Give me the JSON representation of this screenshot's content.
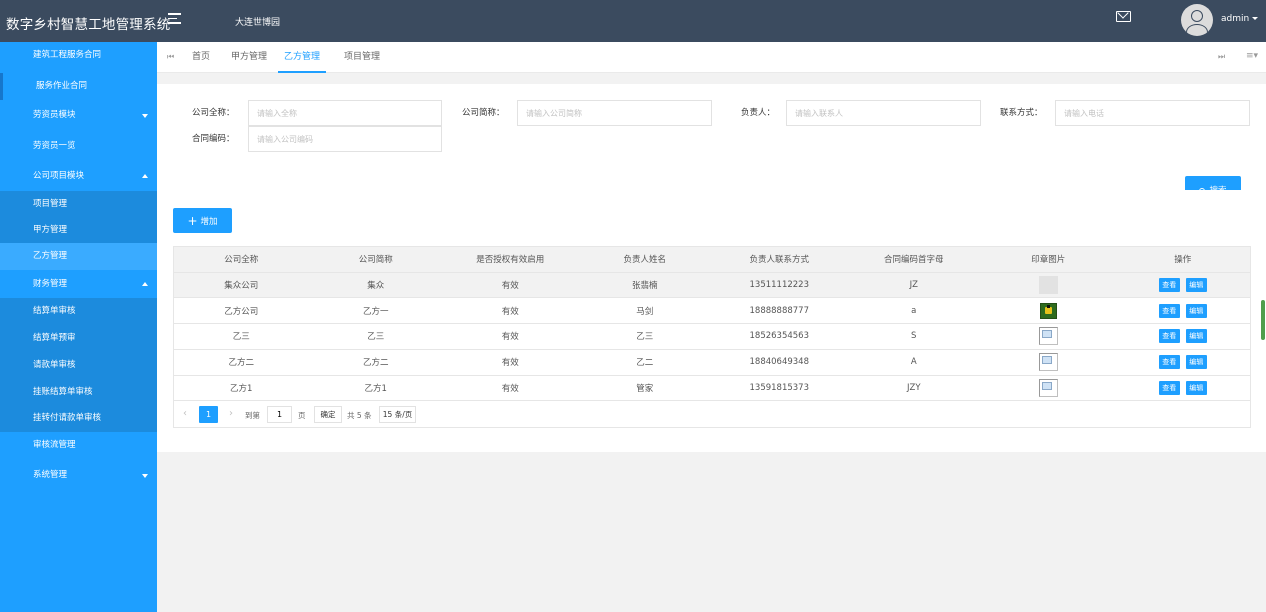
{
  "app": {
    "title": "数字乡村智慧工地管理系统",
    "location": "大连世博园"
  },
  "user": {
    "name": "admin"
  },
  "sidebar": {
    "items": [
      {
        "label": "建筑工程服务合同"
      },
      {
        "label": "服务作业合同"
      },
      {
        "label": "劳资员模块"
      },
      {
        "label": "劳资员一览"
      },
      {
        "label": "公司项目模块"
      },
      {
        "label": "项目管理"
      },
      {
        "label": "甲方管理"
      },
      {
        "label": "乙方管理"
      },
      {
        "label": "财务管理"
      },
      {
        "label": "结算单审核"
      },
      {
        "label": "结算单预审"
      },
      {
        "label": "请款单审核"
      },
      {
        "label": "挂账结算单审核"
      },
      {
        "label": "挂转付请款单审核"
      },
      {
        "label": "审核流管理"
      },
      {
        "label": "系统管理"
      }
    ]
  },
  "tabs": [
    {
      "label": "首页"
    },
    {
      "label": "甲方管理"
    },
    {
      "label": "乙方管理"
    },
    {
      "label": "项目管理"
    }
  ],
  "search": {
    "full_name_label": "公司全称：",
    "full_name_placeholder": "请输入全称",
    "short_name_label": "公司简称：",
    "short_name_placeholder": "请输入公司简称",
    "manager_label": "负责人：",
    "manager_placeholder": "请输入联系人",
    "contact_label": "联系方式：",
    "contact_placeholder": "请输入电话",
    "contract_label": "合同编码：",
    "contract_placeholder": "请输入公司编码",
    "button_label": "搜索"
  },
  "toolbar": {
    "add_label": "增加"
  },
  "table": {
    "headers": [
      "公司全称",
      "公司简称",
      "是否授权有效启用",
      "负责人姓名",
      "负责人联系方式",
      "合同编码首字母",
      "印章图片",
      "操作"
    ],
    "rows": [
      {
        "full": "集众公司",
        "short": "集众",
        "status": "有效",
        "manager": "张翡楠",
        "phone": "13511112223",
        "code": "JZ",
        "seal": "blank"
      },
      {
        "full": "乙方公司",
        "short": "乙方一",
        "status": "有效",
        "manager": "马剑",
        "phone": "18888888777",
        "code": "a",
        "seal": "image"
      },
      {
        "full": "乙三",
        "short": "乙三",
        "status": "有效",
        "manager": "乙三",
        "phone": "18526354563",
        "code": "S",
        "seal": "broken"
      },
      {
        "full": "乙方二",
        "short": "乙方二",
        "status": "有效",
        "manager": "乙二",
        "phone": "18840649348",
        "code": "A",
        "seal": "broken"
      },
      {
        "full": "乙方1",
        "short": "乙方1",
        "status": "有效",
        "manager": "管家",
        "phone": "13591815373",
        "code": "JZY",
        "seal": "broken"
      }
    ],
    "view_label": "查看",
    "edit_label": "编辑"
  },
  "pagination": {
    "current": "1",
    "goto_label": "到第",
    "goto_value": "1",
    "page_label": "页",
    "confirm_label": "确定",
    "total_label": "共 5 条",
    "page_size": "15 条/页"
  },
  "colors": {
    "accent": "#1e9fff",
    "topbar": "#3b4b5f",
    "sidebar": "#1e9fff"
  }
}
